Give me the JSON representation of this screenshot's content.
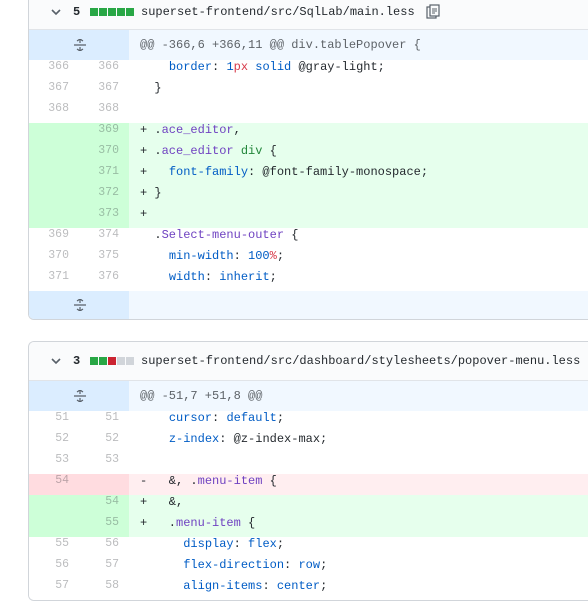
{
  "files": [
    {
      "count": "5",
      "blocks": [
        "#28a745",
        "#28a745",
        "#28a745",
        "#28a745",
        "#28a745"
      ],
      "path": "superset-frontend/src/SqlLab/main.less",
      "hunk": "@@ -366,6 +366,11 @@ div.tablePopover {",
      "lines": [
        {
          "kind": "ctx",
          "old": "366",
          "new": "366",
          "sign": " ",
          "tokens": [
            {
              "t": "  "
            },
            {
              "t": "border",
              "c": "n"
            },
            {
              "t": ": "
            },
            {
              "t": "1",
              "c": "n"
            },
            {
              "t": "px",
              "c": "x"
            },
            {
              "t": " "
            },
            {
              "t": "solid",
              "c": "n"
            },
            {
              "t": " @gray-light;"
            }
          ]
        },
        {
          "kind": "ctx",
          "old": "367",
          "new": "367",
          "sign": " ",
          "tokens": [
            {
              "t": "}"
            }
          ]
        },
        {
          "kind": "ctx",
          "old": "368",
          "new": "368",
          "sign": " ",
          "tokens": []
        },
        {
          "kind": "add",
          "old": "",
          "new": "369",
          "sign": "+",
          "tokens": [
            {
              "t": "."
            },
            {
              "t": "ace_editor",
              "c": "s"
            },
            {
              "t": ","
            }
          ]
        },
        {
          "kind": "add",
          "old": "",
          "new": "370",
          "sign": "+",
          "tokens": [
            {
              "t": "."
            },
            {
              "t": "ace_editor",
              "c": "s"
            },
            {
              "t": " "
            },
            {
              "t": "div",
              "c": "t"
            },
            {
              "t": " {"
            }
          ]
        },
        {
          "kind": "add",
          "old": "",
          "new": "371",
          "sign": "+",
          "tokens": [
            {
              "t": "  "
            },
            {
              "t": "font-family",
              "c": "n"
            },
            {
              "t": ": @font-family-monospace;"
            }
          ]
        },
        {
          "kind": "add",
          "old": "",
          "new": "372",
          "sign": "+",
          "tokens": [
            {
              "t": "}"
            }
          ]
        },
        {
          "kind": "add",
          "old": "",
          "new": "373",
          "sign": "+",
          "tokens": []
        },
        {
          "kind": "ctx",
          "old": "369",
          "new": "374",
          "sign": " ",
          "tokens": [
            {
              "t": "."
            },
            {
              "t": "Select-menu-outer",
              "c": "s"
            },
            {
              "t": " {"
            }
          ]
        },
        {
          "kind": "ctx",
          "old": "370",
          "new": "375",
          "sign": " ",
          "tokens": [
            {
              "t": "  "
            },
            {
              "t": "min-width",
              "c": "n"
            },
            {
              "t": ": "
            },
            {
              "t": "100",
              "c": "n"
            },
            {
              "t": "%",
              "c": "x"
            },
            {
              "t": ";"
            }
          ]
        },
        {
          "kind": "ctx",
          "old": "371",
          "new": "376",
          "sign": " ",
          "tokens": [
            {
              "t": "  "
            },
            {
              "t": "width",
              "c": "n"
            },
            {
              "t": ": "
            },
            {
              "t": "inherit",
              "c": "n"
            },
            {
              "t": ";"
            }
          ]
        }
      ],
      "hunk_end": true
    },
    {
      "count": "3",
      "blocks": [
        "#28a745",
        "#28a745",
        "#cb2431",
        "#d1d5da",
        "#d1d5da"
      ],
      "path": "superset-frontend/src/dashboard/stylesheets/popover-menu.less",
      "hunk": "@@ -51,7 +51,8 @@",
      "lines": [
        {
          "kind": "ctx",
          "old": "51",
          "new": "51",
          "sign": " ",
          "tokens": [
            {
              "t": "  "
            },
            {
              "t": "cursor",
              "c": "n"
            },
            {
              "t": ": "
            },
            {
              "t": "default",
              "c": "n"
            },
            {
              "t": ";"
            }
          ]
        },
        {
          "kind": "ctx",
          "old": "52",
          "new": "52",
          "sign": " ",
          "tokens": [
            {
              "t": "  "
            },
            {
              "t": "z-index",
              "c": "n"
            },
            {
              "t": ": @z-index-max;"
            }
          ]
        },
        {
          "kind": "ctx",
          "old": "53",
          "new": "53",
          "sign": " ",
          "tokens": []
        },
        {
          "kind": "del",
          "old": "54",
          "new": "",
          "sign": "-",
          "tokens": [
            {
              "t": "  &, ."
            },
            {
              "t": "menu-item",
              "c": "s"
            },
            {
              "t": " {"
            }
          ]
        },
        {
          "kind": "add",
          "old": "",
          "new": "54",
          "sign": "+",
          "tokens": [
            {
              "t": "  &,"
            }
          ]
        },
        {
          "kind": "add",
          "old": "",
          "new": "55",
          "sign": "+",
          "tokens": [
            {
              "t": "  ."
            },
            {
              "t": "menu-item",
              "c": "s"
            },
            {
              "t": " {"
            }
          ]
        },
        {
          "kind": "ctx",
          "old": "55",
          "new": "56",
          "sign": " ",
          "tokens": [
            {
              "t": "    "
            },
            {
              "t": "display",
              "c": "n"
            },
            {
              "t": ": "
            },
            {
              "t": "flex",
              "c": "n"
            },
            {
              "t": ";"
            }
          ]
        },
        {
          "kind": "ctx",
          "old": "56",
          "new": "57",
          "sign": " ",
          "tokens": [
            {
              "t": "    "
            },
            {
              "t": "flex-direction",
              "c": "n"
            },
            {
              "t": ": "
            },
            {
              "t": "row",
              "c": "n"
            },
            {
              "t": ";"
            }
          ]
        },
        {
          "kind": "ctx",
          "old": "57",
          "new": "58",
          "sign": " ",
          "tokens": [
            {
              "t": "    "
            },
            {
              "t": "align-items",
              "c": "n"
            },
            {
              "t": ": "
            },
            {
              "t": "center",
              "c": "n"
            },
            {
              "t": ";"
            }
          ]
        }
      ],
      "hunk_end": false
    }
  ]
}
